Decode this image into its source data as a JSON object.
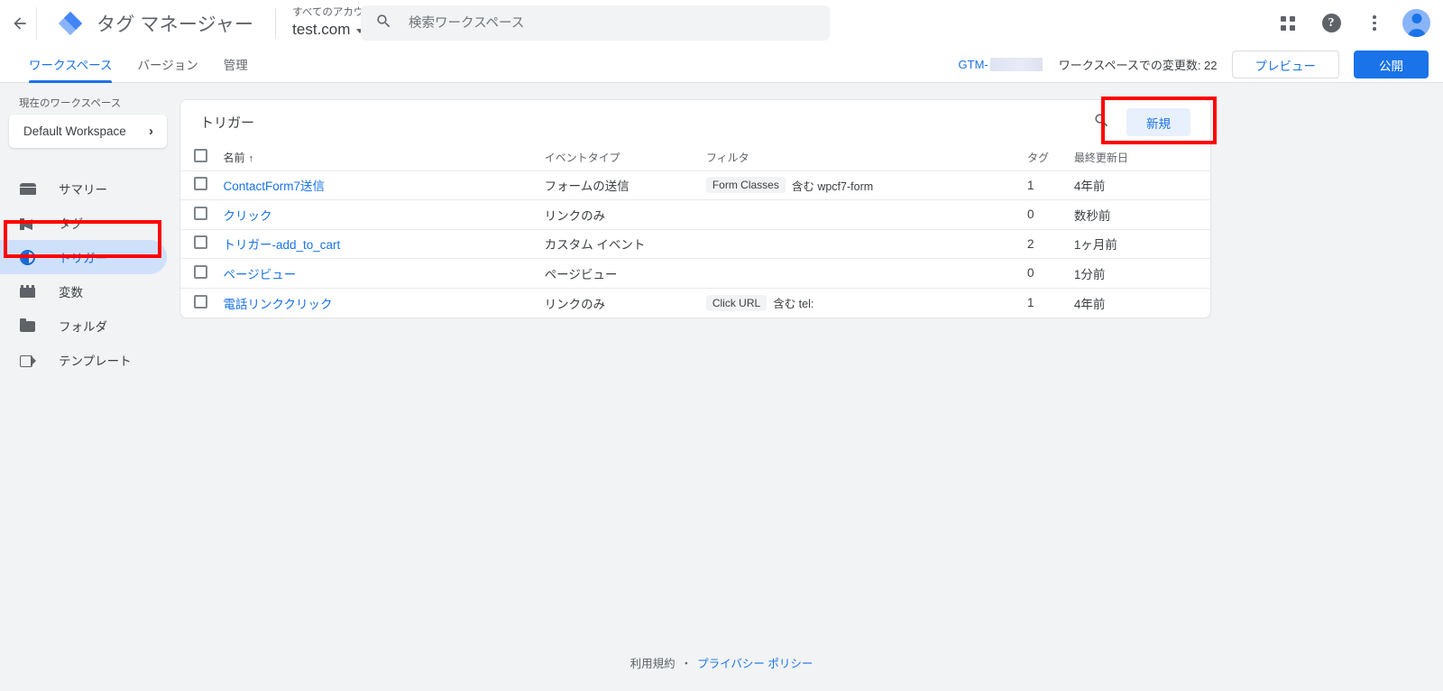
{
  "header": {
    "back_icon": "arrow-left-icon",
    "logo_icon": "gtm-diamond-logo",
    "product_name": "タグ マネージャー",
    "account_path": "すべてのアカウント › テスト",
    "container_name": "test.com",
    "search": {
      "icon": "search-icon",
      "placeholder": "検索ワークスペース",
      "value": ""
    },
    "apps_icon": "apps-grid-icon",
    "help_icon": "help-circle-icon",
    "more_icon": "kebab-menu-icon",
    "avatar_icon": "user-avatar"
  },
  "tabbar": {
    "tabs": [
      {
        "label": "ワークスペース",
        "active": true
      },
      {
        "label": "バージョン",
        "active": false
      },
      {
        "label": "管理",
        "active": false
      }
    ],
    "gtm_id_prefix": "GTM-",
    "gtm_id_redacted": true,
    "changes_label": "ワークスペースでの変更数: 22",
    "preview_button": "プレビュー",
    "publish_button": "公開"
  },
  "sidebar": {
    "workspace_label": "現在のワークスペース",
    "workspace_name": "Default Workspace",
    "workspace_chevron": "chevron-right-icon",
    "items": [
      {
        "label": "サマリー",
        "icon": "summary-icon",
        "active": false
      },
      {
        "label": "タグ",
        "icon": "tag-icon",
        "active": false
      },
      {
        "label": "トリガー",
        "icon": "trigger-icon",
        "active": true
      },
      {
        "label": "変数",
        "icon": "variable-icon",
        "active": false
      },
      {
        "label": "フォルダ",
        "icon": "folder-icon",
        "active": false
      },
      {
        "label": "テンプレート",
        "icon": "template-icon",
        "active": false
      }
    ]
  },
  "main": {
    "card_title": "トリガー",
    "search_icon": "search-icon",
    "new_button": "新規",
    "columns": {
      "name": "名前",
      "sort_arrow": "↑",
      "event_type": "イベントタイプ",
      "filter": "フィルタ",
      "tags": "タグ",
      "last_updated": "最終更新日"
    },
    "rows": [
      {
        "name": "ContactForm7送信",
        "event_type": "フォームの送信",
        "filter_chip": "Form Classes",
        "filter_rest": "含む wpcf7-form",
        "tags": "1",
        "last_updated": "4年前"
      },
      {
        "name": "クリック",
        "event_type": "リンクのみ",
        "filter_chip": "",
        "filter_rest": "",
        "tags": "0",
        "last_updated": "数秒前"
      },
      {
        "name": "トリガー-add_to_cart",
        "event_type": "カスタム イベント",
        "filter_chip": "",
        "filter_rest": "",
        "tags": "2",
        "last_updated": "1ヶ月前"
      },
      {
        "name": "ページビュー",
        "event_type": "ページビュー",
        "filter_chip": "",
        "filter_rest": "",
        "tags": "0",
        "last_updated": "1分前"
      },
      {
        "name": "電話リンククリック",
        "event_type": "リンクのみ",
        "filter_chip": "Click URL",
        "filter_rest": "含む tel:",
        "tags": "1",
        "last_updated": "4年前"
      }
    ]
  },
  "footer": {
    "terms": "利用規約",
    "separator": "・",
    "privacy": "プライバシー ポリシー"
  },
  "annotations": {
    "highlight_color": "#ff0000",
    "boxes": [
      "new-trigger-button",
      "sidebar-item-trigger"
    ]
  },
  "colors": {
    "accent": "#1a73e8",
    "page_bg": "#f1f3f4",
    "active_nav": "#cfe0fb",
    "new_button_bg": "#e8f0fe"
  }
}
